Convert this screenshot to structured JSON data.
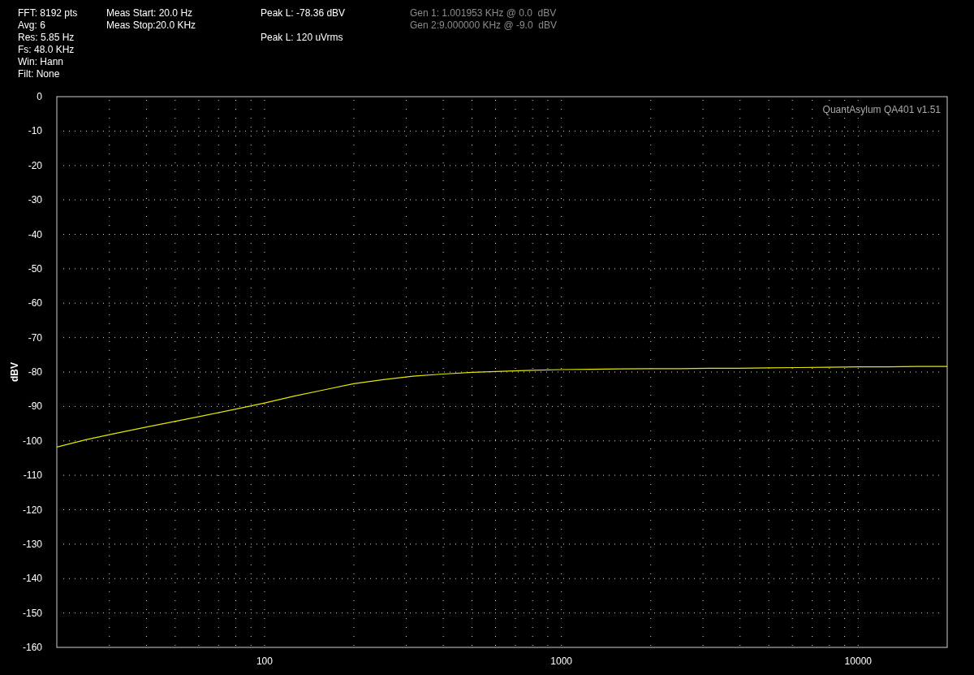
{
  "header": {
    "settings": [
      "FFT: 8192 pts",
      "Avg: 6",
      "Res: 5.85 Hz",
      "Fs: 48.0 KHz",
      "Win: Hann",
      "Filt: None"
    ],
    "measurement": [
      "Meas Start: 20.0 Hz",
      "Meas Stop:20.0 KHz"
    ],
    "peak_level": "Peak L: -78.36 dBV",
    "peak_rms": "Peak L: 120 uVrms",
    "generators": [
      "Gen 1: 1.001953 KHz @ 0.0  dBV",
      "Gen 2:9.000000 KHz @ -9.0  dBV"
    ]
  },
  "plot": {
    "version_label": "QuantAsylum QA401 v1.51",
    "chart_data": {
      "type": "line",
      "ylabel": "dBV",
      "categories": [
        null,
        null,
        null,
        null,
        null,
        null,
        null,
        "100",
        null,
        null,
        null,
        null,
        null,
        null,
        null,
        null,
        null,
        "1000",
        null,
        null,
        null,
        null,
        null,
        null,
        null,
        null,
        null,
        "10000",
        null,
        null,
        null
      ],
      "values": [
        -101.8,
        -99.6,
        -97.8,
        -96.0,
        -94.3,
        -92.6,
        -90.8,
        -89.0,
        -87.0,
        -85.2,
        -83.4,
        -82.2,
        -81.2,
        -80.6,
        -80.1,
        -79.8,
        -79.5,
        -79.3,
        -79.2,
        -79.1,
        -79.0,
        -79.0,
        -78.9,
        -78.9,
        -78.8,
        -78.7,
        -78.6,
        -78.5,
        -78.5,
        -78.4,
        -78.4
      ],
      "ylim": [
        -160,
        0
      ],
      "grid": true,
      "yticks": [
        0,
        -10,
        -20,
        -30,
        -40,
        -50,
        -60,
        -70,
        -80,
        -90,
        -100,
        -110,
        -120,
        -130,
        -140,
        -150,
        -160
      ]
    }
  }
}
